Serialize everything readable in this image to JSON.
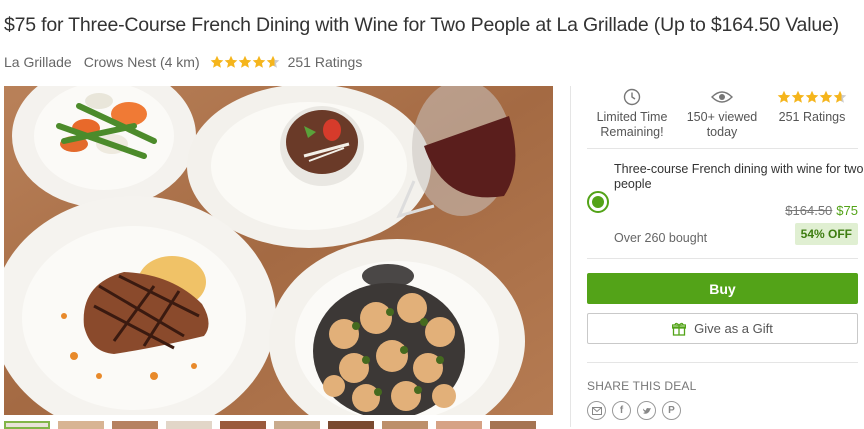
{
  "deal": {
    "title": "$75 for Three-Course French Dining with Wine for Two People at La Grillade (Up to $164.50 Value)",
    "merchant": "La Grillade",
    "location": "Crows Nest (4 km)",
    "rating_count": "251 Ratings"
  },
  "stats": {
    "time": "Limited Time Remaining!",
    "viewed": "150+ viewed today",
    "ratings": "251 Ratings"
  },
  "option": {
    "title": "Three-course French dining with wine for two people",
    "original_price": "$164.50",
    "price": "$75",
    "bought": "Over 260 bought",
    "discount": "54% OFF"
  },
  "actions": {
    "buy_label": "Buy",
    "gift_label": "Give as a Gift"
  },
  "share": {
    "label": "SHARE THIS DEAL",
    "icons": [
      "email-icon",
      "facebook-icon",
      "twitter-icon",
      "pinterest-icon"
    ]
  },
  "colors": {
    "accent": "#53a318",
    "star": "#f5b51c"
  }
}
